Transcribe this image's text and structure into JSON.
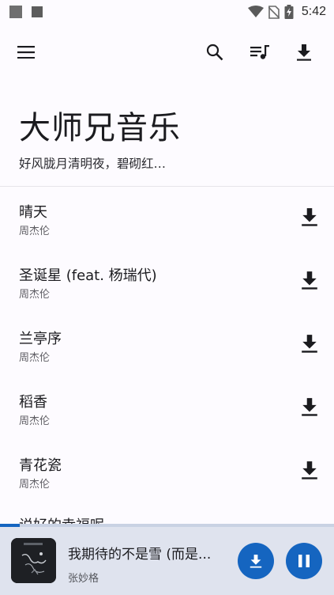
{
  "status_bar": {
    "time": "5:42"
  },
  "header": {
    "title": "大师兄音乐",
    "subtitle": "好风胧月清明夜，碧砌红…"
  },
  "songs": [
    {
      "title": "晴天",
      "artist": "周杰伦"
    },
    {
      "title": "圣诞星 (feat. 杨瑞代)",
      "artist": "周杰伦"
    },
    {
      "title": "兰亭序",
      "artist": "周杰伦"
    },
    {
      "title": "稻香",
      "artist": "周杰伦"
    },
    {
      "title": "青花瓷",
      "artist": "周杰伦"
    }
  ],
  "partial_song": {
    "title": "说好的幸福呢"
  },
  "player": {
    "title": "我期待的不是雪 (而是...",
    "artist": "张妙格",
    "progress": 0.06
  },
  "colors": {
    "accent": "#1565c0",
    "background": "#fdfbff",
    "player_bg": "#dfe3ee"
  },
  "icons": {
    "menu": "menu-icon",
    "search": "search-icon",
    "queue": "queue-music-icon",
    "download": "download-icon",
    "pause": "pause-icon"
  }
}
